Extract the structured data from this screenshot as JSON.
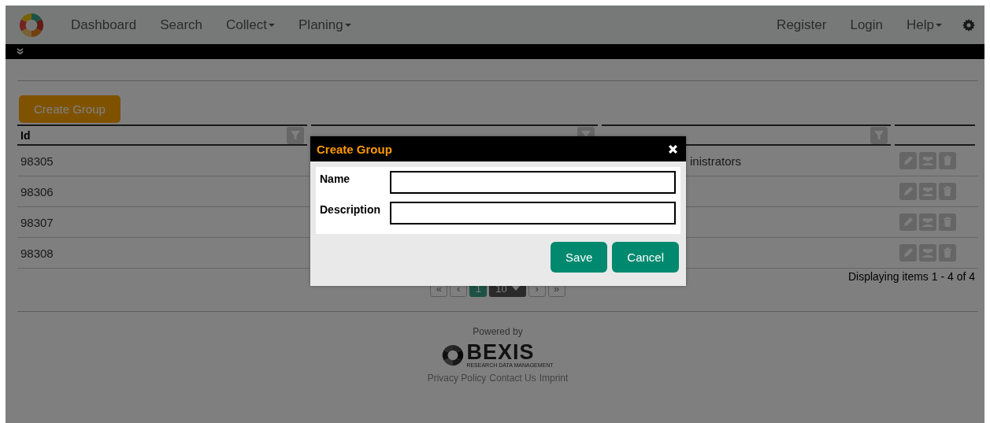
{
  "navbar": {
    "items": [
      {
        "label": "Dashboard",
        "dropdown": false
      },
      {
        "label": "Search",
        "dropdown": false
      },
      {
        "label": "Collect",
        "dropdown": true
      },
      {
        "label": "Planing",
        "dropdown": true
      }
    ],
    "right_items": [
      {
        "label": "Register",
        "dropdown": false
      },
      {
        "label": "Login",
        "dropdown": false
      },
      {
        "label": "Help",
        "dropdown": true
      }
    ]
  },
  "create_button": "Create Group",
  "table": {
    "columns": [
      {
        "label": "Id",
        "filterable": true
      },
      {
        "filterable": true
      },
      {
        "filterable": true
      },
      {
        "filterable": false
      }
    ],
    "rows": [
      {
        "id": "98305",
        "description": "inistrators"
      },
      {
        "id": "98306"
      },
      {
        "id": "98307"
      },
      {
        "id": "98308"
      }
    ]
  },
  "pagination": {
    "first": "«",
    "prev": "‹",
    "pages": [
      {
        "label": "1",
        "selected": true
      }
    ],
    "page_size": "10",
    "next": "›",
    "last": "»",
    "summary": "Displaying items 1 - 4 of 4"
  },
  "footer": {
    "powered_by": "Powered by",
    "brand": "BEXIS",
    "tagline": "RESEARCH DATA MANAGEMENT",
    "links": [
      "Privacy Policy",
      "Contact Us",
      "Imprint"
    ]
  },
  "modal": {
    "title": "Create Group",
    "fields": [
      {
        "label": "Name"
      },
      {
        "label": "Description"
      }
    ],
    "buttons": [
      {
        "label": "Save"
      },
      {
        "label": "Cancel"
      }
    ]
  }
}
